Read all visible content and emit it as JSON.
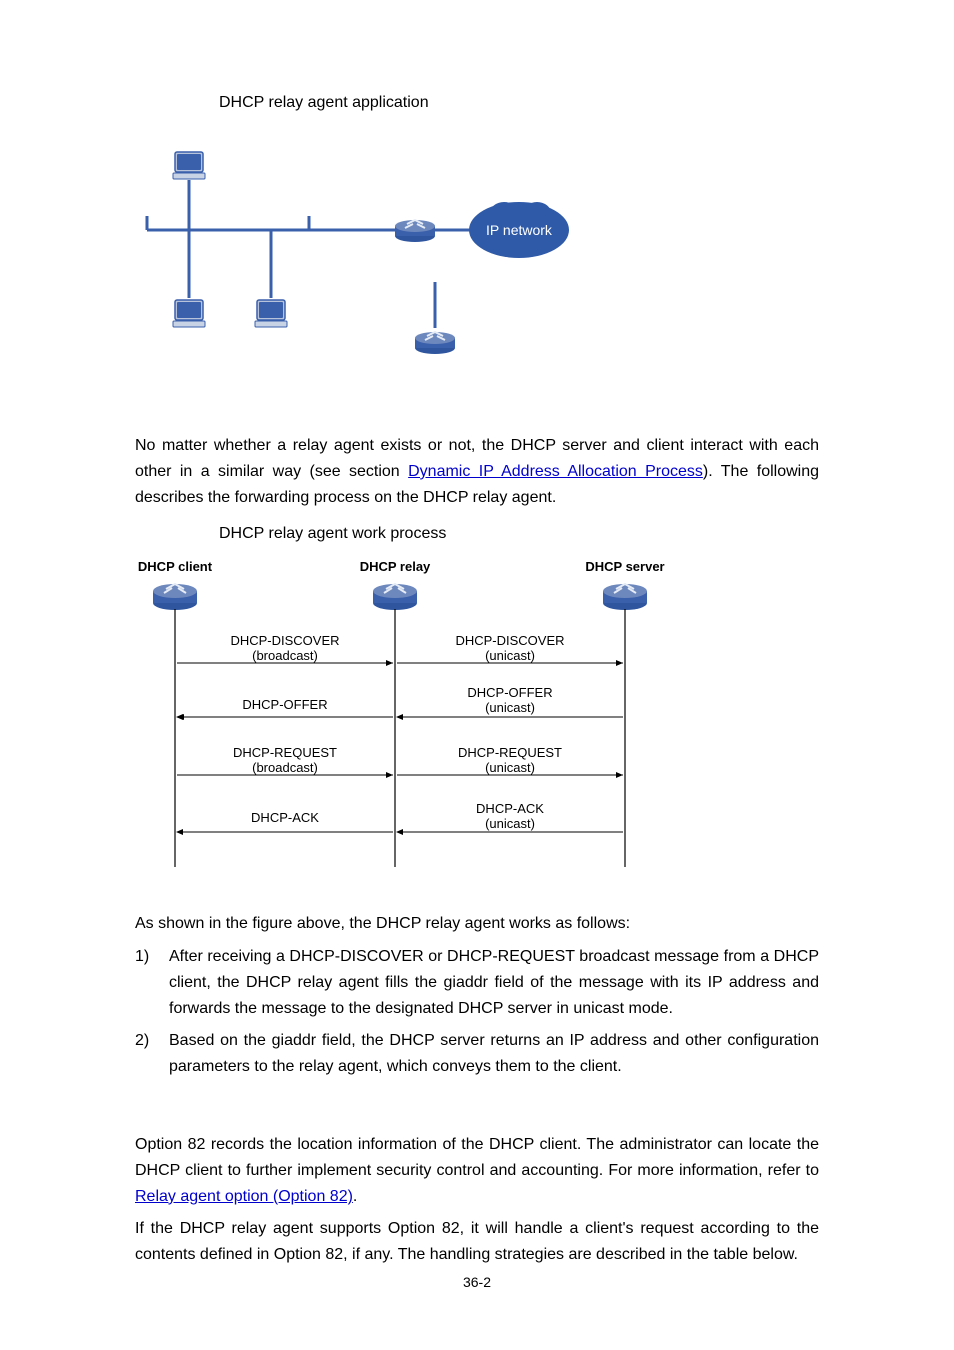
{
  "figure1": {
    "caption": "DHCP relay agent application",
    "cloud_label": "IP network"
  },
  "para_between": {
    "pre": "No matter whether a relay agent exists or not, the DHCP server and client interact with each other in a similar way (see section ",
    "link_text": "Dynamic IP Address Allocation Process",
    "post": "). The following describes the forwarding process on the DHCP relay agent."
  },
  "figure2": {
    "caption": "DHCP relay agent work process",
    "col_client": "DHCP client",
    "col_relay": "DHCP relay",
    "col_server": "DHCP server",
    "msgs_left": [
      {
        "l1": "DHCP-DISCOVER",
        "l2": "(broadcast)"
      },
      {
        "l1": "DHCP-OFFER",
        "l2": ""
      },
      {
        "l1": "DHCP-REQUEST",
        "l2": "(broadcast)"
      },
      {
        "l1": "DHCP-ACK",
        "l2": ""
      }
    ],
    "msgs_right": [
      {
        "l1": "DHCP-DISCOVER",
        "l2": "(unicast)"
      },
      {
        "l1": "DHCP-OFFER",
        "l2": "(unicast)"
      },
      {
        "l1": "DHCP-REQUEST",
        "l2": "(unicast)"
      },
      {
        "l1": "DHCP-ACK",
        "l2": "(unicast)"
      }
    ]
  },
  "para_after_fig2": "As shown in the figure above, the DHCP relay agent works as follows:",
  "list": {
    "items": [
      {
        "num": "1)",
        "text": "After receiving a DHCP-DISCOVER or DHCP-REQUEST broadcast message from a DHCP client, the DHCP relay agent fills the giaddr field of the message with its IP address and forwards the message to the designated DHCP server in unicast mode."
      },
      {
        "num": "2)",
        "text": "Based on the giaddr field, the DHCP server returns an IP address and other configuration parameters to the relay agent, which conveys them to the client."
      }
    ]
  },
  "opt82_p1": {
    "pre": "Option 82 records the location information of the DHCP client. The administrator can locate the DHCP client to further implement security control and accounting. For more information, refer to ",
    "link_text": "Relay agent option (Option 82)",
    "post": "."
  },
  "opt82_p2": "If the DHCP relay agent supports Option 82, it will handle a client's request according to the contents defined in Option 82, if any. The handling strategies are described in the table below.",
  "page_number": "36-2",
  "colors": {
    "link": "#0000cc",
    "device_blue": "#3a5fab",
    "device_light": "#b6c3da",
    "cloud": "#2f5aa8"
  }
}
